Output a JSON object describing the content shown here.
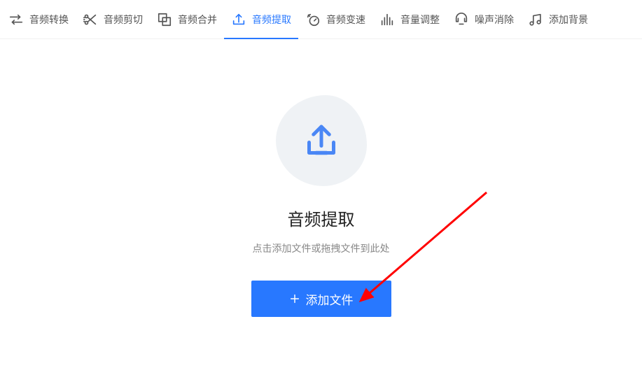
{
  "tabs": [
    {
      "label": "音频转换"
    },
    {
      "label": "音频剪切"
    },
    {
      "label": "音频合并"
    },
    {
      "label": "音频提取"
    },
    {
      "label": "音频变速"
    },
    {
      "label": "音量调整"
    },
    {
      "label": "噪声消除"
    },
    {
      "label": "添加背景"
    }
  ],
  "main": {
    "title": "音频提取",
    "desc": "点击添加文件或拖拽文件到此处",
    "button": "添加文件"
  }
}
